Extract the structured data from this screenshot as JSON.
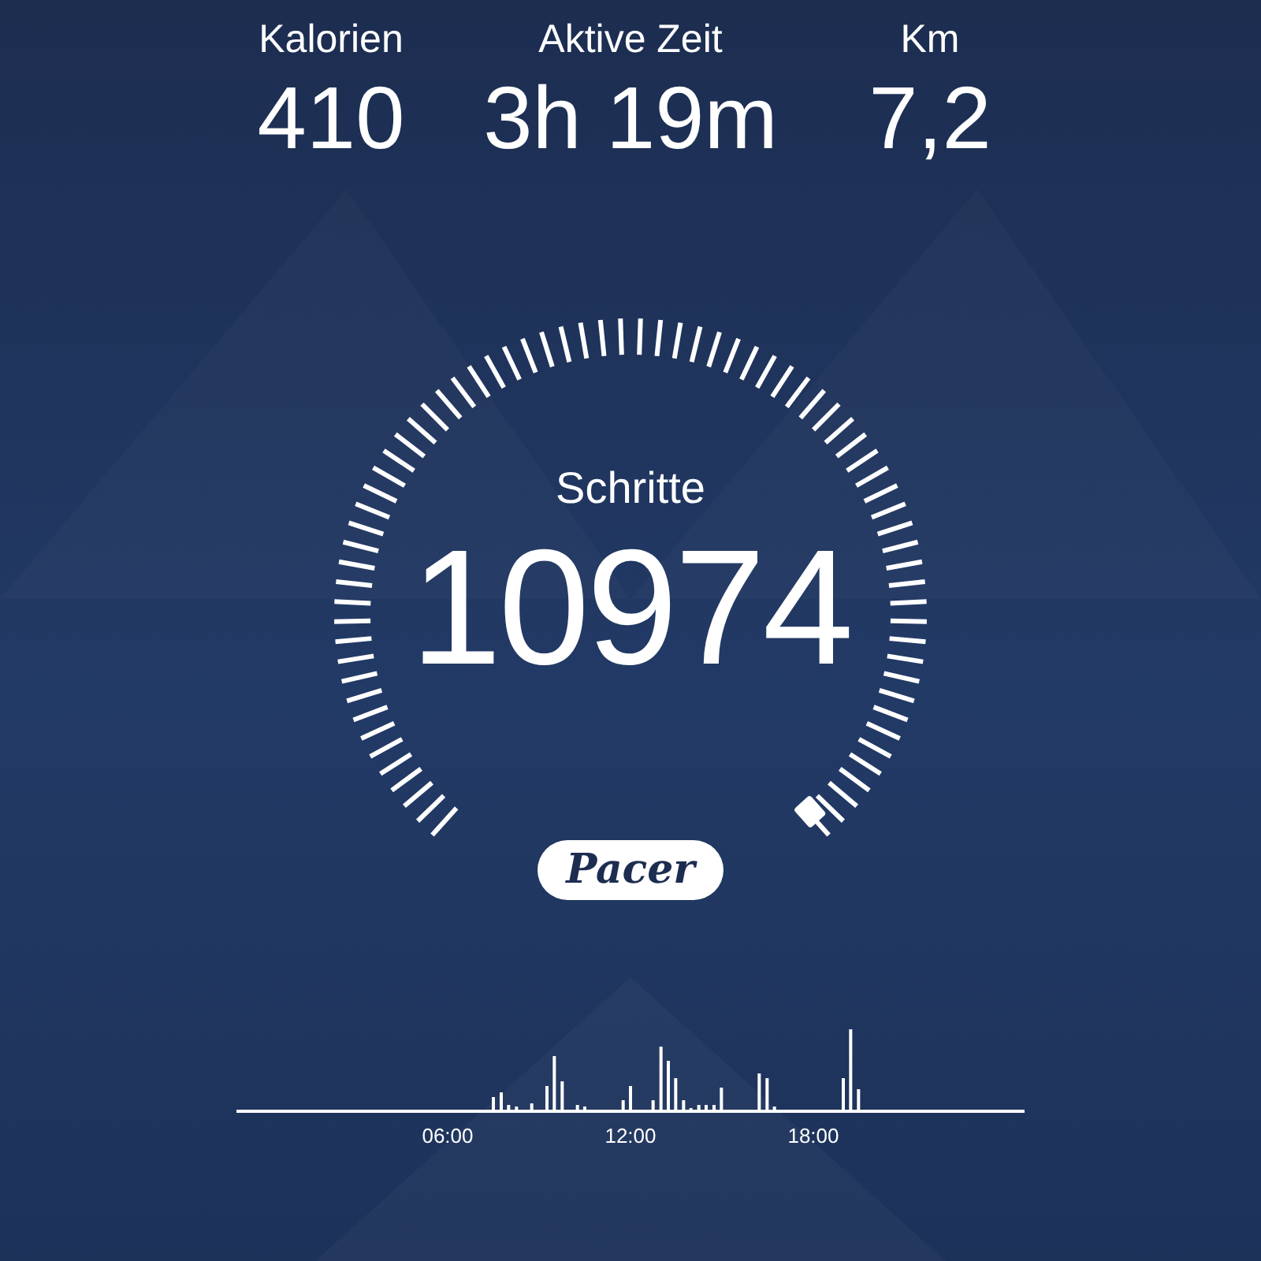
{
  "stats": [
    {
      "label": "Kalorien",
      "value": "410"
    },
    {
      "label": "Aktive Zeit",
      "value": "3h 19m"
    },
    {
      "label": "Km",
      "value": "7,2"
    }
  ],
  "gauge": {
    "label": "Schritte",
    "value": "10974"
  },
  "badge": "Pacer",
  "activity_chart": {
    "time_labels": [
      "06:00",
      "12:00",
      "18:00"
    ]
  }
}
